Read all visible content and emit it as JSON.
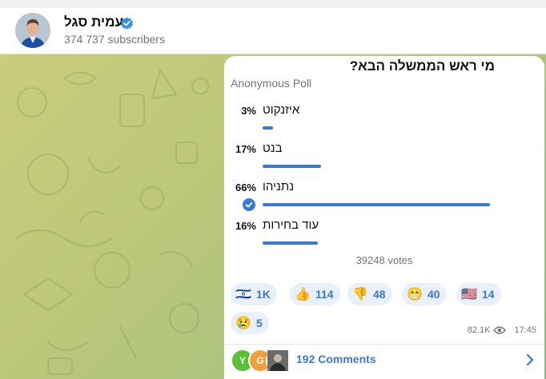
{
  "channel": {
    "name": "עמית סגל",
    "subscribers": "374 737 subscribers"
  },
  "poll": {
    "question": "מי ראש הממשלה הבא?",
    "type_label": "Anonymous Poll",
    "options": [
      {
        "label": "איזנקוט",
        "percent_label": "3%",
        "percent": 3,
        "chosen": false
      },
      {
        "label": "בנט",
        "percent_label": "17%",
        "percent": 17,
        "chosen": false
      },
      {
        "label": "נתניהו",
        "percent_label": "66%",
        "percent": 66,
        "chosen": true
      },
      {
        "label": "עוד בחירות",
        "percent_label": "16%",
        "percent": 16,
        "chosen": false
      }
    ],
    "votes": "39248 votes"
  },
  "reactions": [
    {
      "emoji": "🇮🇱",
      "count": "1K"
    },
    {
      "emoji": "👍",
      "count": "114"
    },
    {
      "emoji": "👎",
      "count": "48"
    },
    {
      "emoji": "😁",
      "count": "40"
    },
    {
      "emoji": "🇺🇸",
      "count": "14"
    },
    {
      "emoji": "😢",
      "count": "5"
    }
  ],
  "message_meta": {
    "views": "82.1K",
    "time": "17:45"
  },
  "comments": {
    "label": "192 Comments",
    "avatars": [
      {
        "letter": "Y",
        "color": "#5bbf3a"
      },
      {
        "letter": "G",
        "color": "#f0a03a"
      },
      {
        "letter": "",
        "color": "#555555"
      }
    ]
  },
  "colors": {
    "accent": "#3a78d6",
    "secondary_text": "#707579"
  }
}
